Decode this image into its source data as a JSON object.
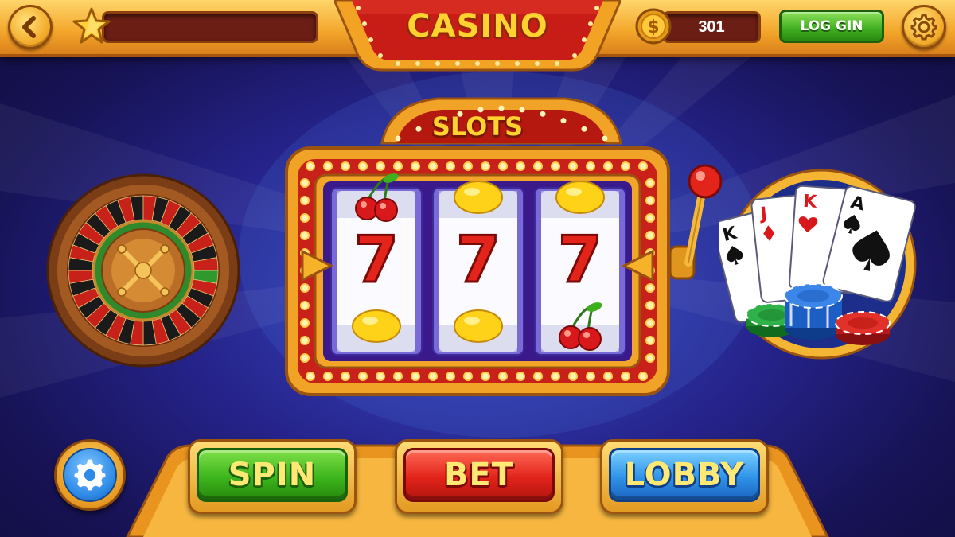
{
  "header": {
    "title": "CASINO",
    "coins": "301",
    "login_label": "LOG GIN"
  },
  "machine": {
    "label": "SLOTS",
    "reels": [
      [
        "cherry",
        "7",
        "lemon"
      ],
      [
        "lemon",
        "7",
        "lemon"
      ],
      [
        "lemon",
        "7",
        "cherry"
      ]
    ],
    "seven_glyph": "7"
  },
  "buttons": {
    "spin": "SPIN",
    "bet": "BET",
    "lobby": "LOBBY"
  },
  "cards": [
    "K",
    "J",
    "K",
    "A"
  ],
  "icons": {
    "back": "chevron-left-icon",
    "star": "star-icon",
    "coin": "dollar-coin-icon",
    "settings": "gear-icon"
  },
  "colors": {
    "background": "#25238a",
    "gold": "#f3a52a",
    "frame_red": "#c8211a",
    "title_yellow": "#ffd230",
    "spin_green": "#3db51c",
    "bet_red": "#e2241b",
    "lobby_blue": "#2f93e8"
  }
}
